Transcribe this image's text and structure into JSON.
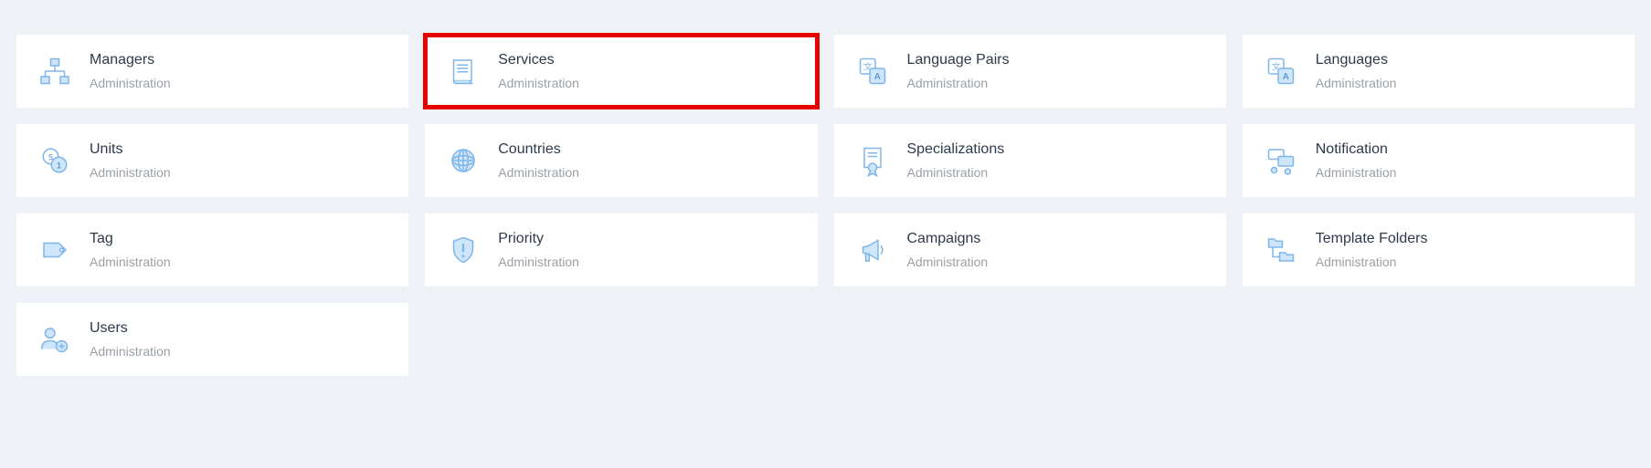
{
  "colors": {
    "page_bg": "#eef1f5",
    "card_bg": "#ffffff",
    "title": "#2d3a4a",
    "subtitle": "#9aa0a6",
    "icon_stroke": "#7eb6ea",
    "icon_fill": "#cfe5fa",
    "highlight": "#e60000"
  },
  "cards": [
    {
      "title": "Managers",
      "subtitle": "Administration",
      "icon": "org-chart-icon",
      "highlighted": false
    },
    {
      "title": "Services",
      "subtitle": "Administration",
      "icon": "document-icon",
      "highlighted": true
    },
    {
      "title": "Language Pairs",
      "subtitle": "Administration",
      "icon": "translate-icon",
      "highlighted": false
    },
    {
      "title": "Languages",
      "subtitle": "Administration",
      "icon": "translate-icon",
      "highlighted": false
    },
    {
      "title": "Units",
      "subtitle": "Administration",
      "icon": "coins-icon",
      "highlighted": false
    },
    {
      "title": "Countries",
      "subtitle": "Administration",
      "icon": "globe-icon",
      "highlighted": false
    },
    {
      "title": "Specializations",
      "subtitle": "Administration",
      "icon": "certificate-icon",
      "highlighted": false
    },
    {
      "title": "Notification",
      "subtitle": "Administration",
      "icon": "chat-icon",
      "highlighted": false
    },
    {
      "title": "Tag",
      "subtitle": "Administration",
      "icon": "tag-icon",
      "highlighted": false
    },
    {
      "title": "Priority",
      "subtitle": "Administration",
      "icon": "shield-icon",
      "highlighted": false
    },
    {
      "title": "Campaigns",
      "subtitle": "Administration",
      "icon": "megaphone-icon",
      "highlighted": false
    },
    {
      "title": "Template Folders",
      "subtitle": "Administration",
      "icon": "folder-tree-icon",
      "highlighted": false
    },
    {
      "title": "Users",
      "subtitle": "Administration",
      "icon": "users-icon",
      "highlighted": false
    }
  ]
}
